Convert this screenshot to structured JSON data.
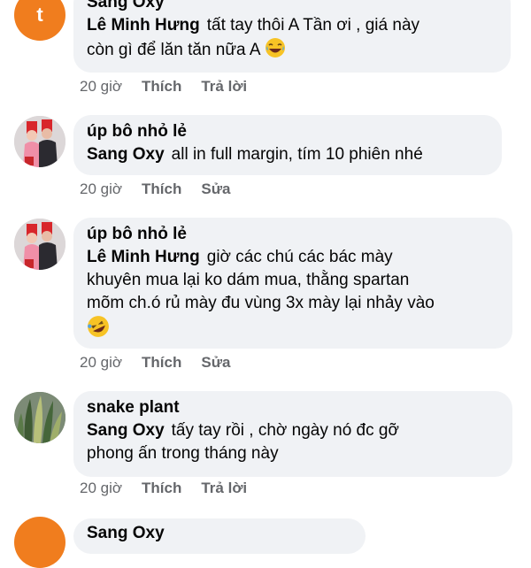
{
  "comments": [
    {
      "avatar_letter": "t",
      "author": "Sang Oxy",
      "mention": "Lê Minh Hưng",
      "text_lines": [
        "tất tay thôi A Tần ơi , giá này",
        "còn gì để lăn tăn nữa A"
      ],
      "emoji": "laughing-tears-emoji",
      "time": "20 giờ",
      "like": "Thích",
      "action": "Trả lời"
    },
    {
      "author": "úp bô nhỏ lẻ",
      "mention": "Sang Oxy",
      "text_lines": [
        "all in full margin, tím 10 phiên nhé"
      ],
      "time": "20 giờ",
      "like": "Thích",
      "action": "Sửa"
    },
    {
      "author": "úp bô nhỏ lẻ",
      "mention": "Lê Minh Hưng",
      "text_lines": [
        "giờ các chú các bác mày",
        "khuyên mua lại ko dám mua, thằng spartan",
        "mõm ch.ó rủ mày đu vùng 3x mày lại nhảy vào"
      ],
      "emoji": "rolling-laughing-emoji",
      "time": "20 giờ",
      "like": "Thích",
      "action": "Sửa"
    },
    {
      "author": "snake plant",
      "mention": "Sang Oxy",
      "text_lines": [
        "tấy tay rồi , chờ ngày nó đc gỡ",
        "phong ấn trong tháng này"
      ],
      "time": "20 giờ",
      "like": "Thích",
      "action": "Trả lời"
    },
    {
      "author": "Sang Oxy"
    }
  ]
}
